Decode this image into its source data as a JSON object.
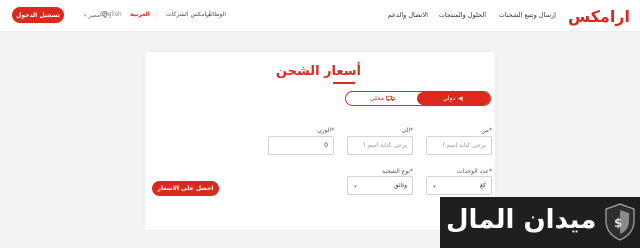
{
  "header": {
    "logo": "ارامكس",
    "nav": [
      "إرسال وتتبع الشحنات",
      "الحلول والمنتجات",
      "الاتصال والدعم"
    ],
    "careers": "الوظائف",
    "companies": "أرامكس الشركات",
    "separator": "|",
    "lang_active": "العربية",
    "lang_other": "English",
    "country": "مصر",
    "login": "تسجيل الدخول"
  },
  "card": {
    "title": "أسعار الشحن",
    "toggle": {
      "international": "دولي",
      "domestic": "محلي"
    },
    "from": {
      "label": "من",
      "required": "*",
      "placeholder": "يرجى كتابة اسم ا"
    },
    "to": {
      "label": "الى",
      "required": "*",
      "placeholder": "يرجى كتابة اسم ا"
    },
    "weight": {
      "label": "الوزن",
      "required": "*",
      "value": "0"
    },
    "units": {
      "label": "عدد الوحدات",
      "required": "*",
      "value": "كغ"
    },
    "type": {
      "label": "نوع الشحنة",
      "required": "*",
      "value": "وثائق"
    },
    "submit": "احصل على الاسعار"
  },
  "watermark": {
    "text": "ميدان المال"
  },
  "colors": {
    "brand": "#dc291e"
  }
}
